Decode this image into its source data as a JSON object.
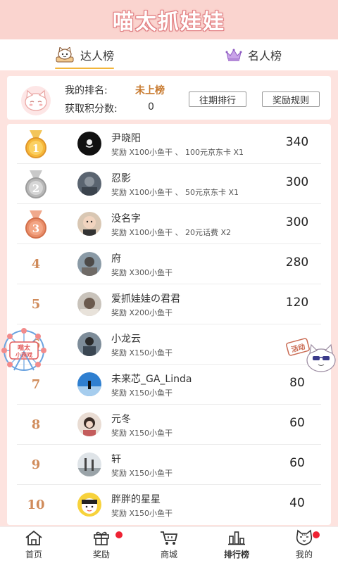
{
  "header": {
    "title": "喵太抓娃娃"
  },
  "tabs": [
    {
      "label": "达人榜",
      "icon": "cat-icon",
      "active": true
    },
    {
      "label": "名人榜",
      "icon": "crown-icon",
      "active": false
    }
  ],
  "my_rank": {
    "rank_label": "我的排名:",
    "rank_value": "未上榜",
    "score_label": "获取积分数:",
    "score_value": "0",
    "history_button": "往期排行",
    "rules_button": "奖励规则"
  },
  "leaderboard": [
    {
      "rank": "1",
      "name": "尹晓阳",
      "reward": "奖励 X100小鱼干 、 100元京东卡 X1",
      "score": "340",
      "medal": "gold"
    },
    {
      "rank": "2",
      "name": "忍影",
      "reward": "奖励 X100小鱼干 、 50元京东卡 X1",
      "score": "300",
      "medal": "silver"
    },
    {
      "rank": "3",
      "name": "没名字",
      "reward": "奖励 X100小鱼干 、 20元话费 X2",
      "score": "300",
      "medal": "bronze"
    },
    {
      "rank": "4",
      "name": "府",
      "reward": "奖励 X300小鱼干",
      "score": "280",
      "medal": ""
    },
    {
      "rank": "5",
      "name": "爱抓娃娃の君君",
      "reward": "奖励 X200小鱼干",
      "score": "120",
      "medal": ""
    },
    {
      "rank": "6",
      "name": "小龙云",
      "reward": "奖励 X150小鱼干",
      "score": "",
      "medal": ""
    },
    {
      "rank": "7",
      "name": "未来芯_GA_Linda",
      "reward": "奖励 X150小鱼干",
      "score": "80",
      "medal": ""
    },
    {
      "rank": "8",
      "name": "元冬",
      "reward": "奖励 X150小鱼干",
      "score": "60",
      "medal": ""
    },
    {
      "rank": "9",
      "name": "轩",
      "reward": "奖励 X150小鱼干",
      "score": "60",
      "medal": ""
    },
    {
      "rank": "10",
      "name": "胖胖的星星",
      "reward": "奖励 X150小鱼干",
      "score": "40",
      "medal": ""
    }
  ],
  "floating": {
    "left_badge": [
      "喵太",
      "小游戏"
    ],
    "right_badge": "活动"
  },
  "bottom_nav": [
    {
      "label": "首页",
      "icon": "home-icon",
      "dot": false,
      "active": false
    },
    {
      "label": "奖励",
      "icon": "gift-icon",
      "dot": true,
      "active": false
    },
    {
      "label": "商城",
      "icon": "cart-icon",
      "dot": false,
      "active": false
    },
    {
      "label": "排行榜",
      "icon": "ranking-icon",
      "dot": false,
      "active": true
    },
    {
      "label": "我的",
      "icon": "cat-face-icon",
      "dot": true,
      "active": false
    }
  ],
  "colors": {
    "background": "#fde3df",
    "header": "#fad4cf",
    "tab_indicator": "#f2b53a",
    "rank_number": "#d08b5a",
    "rank_highlight": "#c87a2f",
    "red_dot": "#ee2233"
  }
}
